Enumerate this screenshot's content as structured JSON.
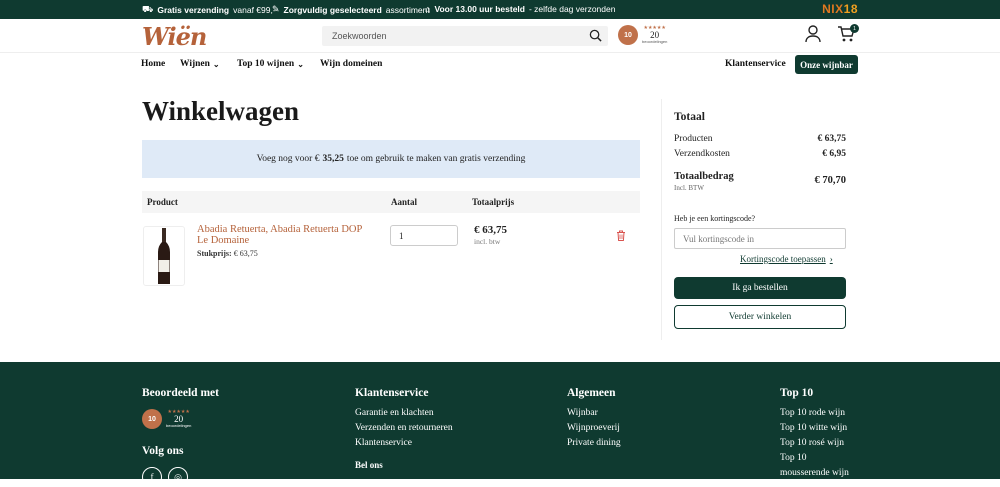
{
  "topbar": {
    "usp1_bold": "Gratis verzending",
    "usp1_rest": "vanaf €99,-",
    "usp2_bold": "Zorgvuldig geselecteerd",
    "usp2_rest": "assortiment",
    "usp3_bold": "Voor 13.00 uur besteld",
    "usp3_rest": "- zelfde dag verzonden",
    "nix_a": "NIX",
    "nix_b": "18"
  },
  "header": {
    "logo": "Wiën",
    "search_placeholder": "Zoekwoorden",
    "rating_badge": "10",
    "rating_stars": "★★★★★",
    "rating_count": "20",
    "rating_label": "beoordelingen",
    "cart_count": "1"
  },
  "nav": {
    "home": "Home",
    "wijnen": "Wijnen",
    "top10": "Top 10 wijnen",
    "domeinen": "Wijn domeinen",
    "klantenservice": "Klantenservice",
    "onze_wijnbar": "Onze wijnbar"
  },
  "cart": {
    "title": "Winkelwagen",
    "notice_before": "Voeg nog voor € ",
    "notice_amount": "35,25",
    "notice_after": " toe om gebruik te maken van gratis verzending",
    "col_product": "Product",
    "col_aantal": "Aantal",
    "col_totaal": "Totaalprijs",
    "item": {
      "name": "Abadia Retuerta, Abadia Retuerta DOP Le Domaine",
      "unit_label": "Stukprijs:",
      "unit_price": "€ 63,75",
      "qty": "1",
      "total": "€ 63,75",
      "incl": "incl. btw"
    }
  },
  "summary": {
    "title": "Totaal",
    "products_label": "Producten",
    "products_value": "€ 63,75",
    "shipping_label": "Verzendkosten",
    "shipping_value": "€ 6,95",
    "total_label": "Totaalbedrag",
    "total_value": "€ 70,70",
    "incl": "Incl. BTW",
    "coupon_question": "Heb je een kortingscode?",
    "coupon_placeholder": "Vul kortingscode in",
    "coupon_link": "Kortingscode toepassen",
    "order_button": "Ik ga bestellen",
    "continue_button": "Verder winkelen"
  },
  "footer": {
    "col1_title": "Beoordeeld met",
    "rating_badge": "10",
    "rating_stars": "★★★★★",
    "rating_count": "20",
    "rating_label": "beoordelingen",
    "follow_title": "Volg ons",
    "col2_title": "Klantenservice",
    "col2_links": [
      "Garantie en klachten",
      "Verzenden en retourneren",
      "Klantenservice"
    ],
    "col2_sub": "Bel ons",
    "col3_title": "Algemeen",
    "col3_links": [
      "Wijnbar",
      "Wijnproeverij",
      "Private dining"
    ],
    "col4_title": "Top 10",
    "col4_links": [
      "Top 10 rode wijn",
      "Top 10 witte wijn",
      "Top 10 rosé wijn",
      "Top 10",
      "mousserende wijn"
    ]
  },
  "colors": {
    "primary": "#0f3a30",
    "accent": "#b5623a",
    "notice_bg": "#dfeaf7"
  }
}
